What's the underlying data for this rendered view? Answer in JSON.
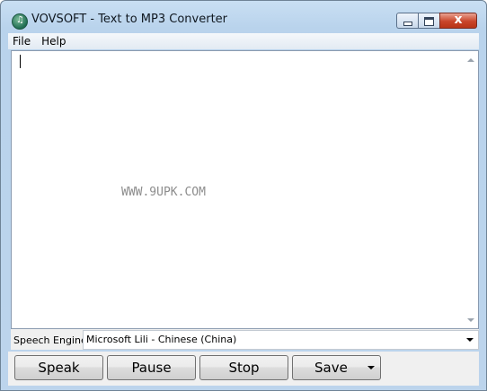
{
  "window": {
    "title": "VOVSOFT - Text to MP3 Converter",
    "close_glyph": "x"
  },
  "icons": {
    "app": "app-logo-icon",
    "minimize": "minimize-icon",
    "maximize": "maximize-icon",
    "close": "close-icon"
  },
  "menu": {
    "items": [
      {
        "label": "File"
      },
      {
        "label": "Help"
      }
    ]
  },
  "editor": {
    "text": "",
    "watermark": "WWW.9UPK.COM"
  },
  "engine": {
    "label": "Speech Engine:",
    "value": "Microsoft Lili - Chinese (China)"
  },
  "buttons": {
    "speak": "Speak",
    "pause": "Pause",
    "stop": "Stop",
    "save": "Save"
  },
  "colors": {
    "title_bar": "#c9dff3",
    "close_button": "#c9452a"
  }
}
